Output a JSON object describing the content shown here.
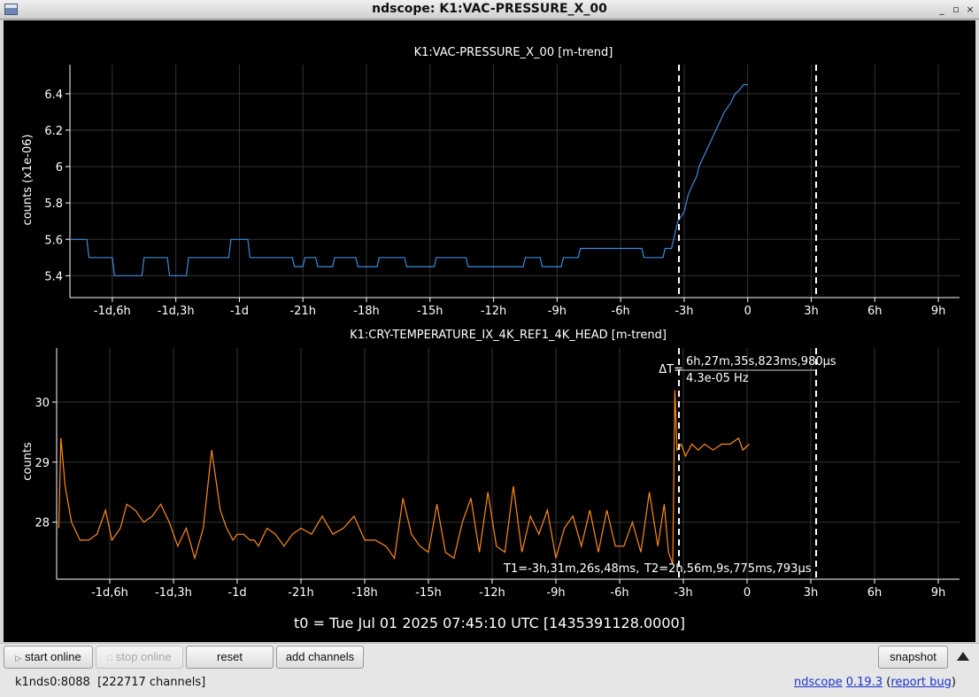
{
  "window": {
    "title": "ndscope: K1:VAC-PRESSURE_X_00"
  },
  "colors": {
    "plot_bg": "#000000",
    "grid": "#333333",
    "axis_text": "#ffffff",
    "series1": "#3c8cd8",
    "series2": "#ff8a1a",
    "cursor": "#ffffff"
  },
  "plots": [
    {
      "title": "K1:VAC-PRESSURE_X_00 [m-trend]",
      "ylabel": "counts (x1e-06)",
      "yticks": [
        "5.4",
        "5.6",
        "5.8",
        "6",
        "6.2",
        "6.4"
      ],
      "xticks": [
        "-1d,6h",
        "-1d,3h",
        "-1d",
        "-21h",
        "-18h",
        "-15h",
        "-12h",
        "-9h",
        "-6h",
        "-3h",
        "0",
        "3h",
        "6h",
        "9h"
      ]
    },
    {
      "title": "K1:CRY-TEMPERATURE_IX_4K_REF1_4K_HEAD [m-trend]",
      "ylabel": "counts",
      "yticks": [
        "28",
        "29",
        "30"
      ],
      "xticks": [
        "-1d,6h",
        "-1d,3h",
        "-1d",
        "-21h",
        "-18h",
        "-15h",
        "-12h",
        "-9h",
        "-6h",
        "-3h",
        "0",
        "3h",
        "6h",
        "9h"
      ],
      "cursor": {
        "delta_label": "ΔT=",
        "delta_value": "6h,27m,35s,823ms,980µs",
        "freq": "4.3e-05 Hz",
        "t1": "T1=-3h,31m,26s,48ms,",
        "t2": "T2=2h,56m,9s,775ms,793µs"
      }
    }
  ],
  "t0_label": "t0 = Tue Jul 01 2025 07:45:10 UTC [1435391128.0000]",
  "toolbar": {
    "start_online": "start online",
    "stop_online": "stop online",
    "reset": "reset",
    "add_channels": "add channels",
    "snapshot": "snapshot"
  },
  "status": {
    "server": "k1nds0:8088",
    "channels": "[222717 channels]",
    "app_name": "ndscope",
    "version": "0.19.3",
    "report_bug": "report bug"
  },
  "chart_data": [
    {
      "type": "line",
      "title": "K1:VAC-PRESSURE_X_00 [m-trend]",
      "ylabel": "counts (x1e-06)",
      "xlabel": "",
      "x_unit": "hours",
      "xlim": [
        -32,
        10
      ],
      "ylim": [
        5.28,
        6.56
      ],
      "grid": true,
      "series": [
        {
          "color": "#3c8cd8",
          "x": [
            -32,
            -31.2,
            -31.1,
            -30,
            -29.9,
            -28.6,
            -28.5,
            -27.4,
            -27.3,
            -26.5,
            -26.4,
            -24.5,
            -24.4,
            -23.6,
            -23.5,
            -21.5,
            -21.4,
            -21.0,
            -20.9,
            -20.4,
            -20.3,
            -19.6,
            -19.5,
            -18.5,
            -18.4,
            -17.5,
            -17.4,
            -16.2,
            -16.1,
            -14.8,
            -14.7,
            -13.3,
            -13.2,
            -10.6,
            -10.5,
            -9.8,
            -9.7,
            -8.8,
            -8.7,
            -8.0,
            -7.9,
            -5.0,
            -4.9,
            -4.0,
            -3.9,
            -3.6,
            -3.5,
            -3.3,
            -3.0,
            -2.8,
            -2.6,
            -2.4,
            -2.3,
            -2.1,
            -1.9,
            -1.7,
            -1.5,
            -1.3,
            -1.1,
            -0.8,
            -0.6,
            -0.4,
            -0.2,
            0.0
          ],
          "y": [
            5.6,
            5.6,
            5.5,
            5.5,
            5.4,
            5.4,
            5.5,
            5.5,
            5.4,
            5.4,
            5.5,
            5.5,
            5.6,
            5.6,
            5.5,
            5.5,
            5.45,
            5.45,
            5.5,
            5.5,
            5.45,
            5.45,
            5.5,
            5.5,
            5.45,
            5.45,
            5.5,
            5.5,
            5.45,
            5.45,
            5.5,
            5.5,
            5.45,
            5.45,
            5.5,
            5.5,
            5.45,
            5.45,
            5.5,
            5.5,
            5.55,
            5.55,
            5.5,
            5.5,
            5.55,
            5.55,
            5.6,
            5.7,
            5.75,
            5.85,
            5.9,
            5.95,
            6.0,
            6.05,
            6.1,
            6.15,
            6.2,
            6.25,
            6.3,
            6.35,
            6.4,
            6.42,
            6.45,
            6.45
          ]
        }
      ]
    },
    {
      "type": "line",
      "title": "K1:CRY-TEMPERATURE_IX_4K_REF1_4K_HEAD [m-trend]",
      "ylabel": "counts",
      "xlabel": "",
      "x_unit": "hours",
      "xlim": [
        -32.5,
        10
      ],
      "ylim": [
        27.05,
        30.9
      ],
      "grid": true,
      "series": [
        {
          "color": "#ff8a1a",
          "x": [
            -32.4,
            -32.3,
            -32.1,
            -31.8,
            -31.4,
            -31.0,
            -30.6,
            -30.2,
            -29.9,
            -29.5,
            -29.2,
            -28.8,
            -28.4,
            -28.0,
            -27.6,
            -27.2,
            -26.8,
            -26.4,
            -26.0,
            -25.6,
            -25.2,
            -24.8,
            -24.5,
            -24.2,
            -24.0,
            -23.7,
            -23.4,
            -23.2,
            -23.0,
            -22.6,
            -22.2,
            -21.8,
            -21.4,
            -21.0,
            -20.5,
            -20.0,
            -19.5,
            -19.0,
            -18.5,
            -18.0,
            -17.5,
            -17.0,
            -16.6,
            -16.2,
            -15.8,
            -15.4,
            -15.0,
            -14.6,
            -14.2,
            -13.8,
            -13.4,
            -13.0,
            -12.6,
            -12.2,
            -11.8,
            -11.4,
            -11.0,
            -10.6,
            -10.2,
            -9.8,
            -9.4,
            -9.0,
            -8.6,
            -8.2,
            -7.8,
            -7.4,
            -7.0,
            -6.6,
            -6.2,
            -5.8,
            -5.4,
            -5.0,
            -4.6,
            -4.2,
            -3.9,
            -3.7,
            -3.5,
            -3.4,
            -3.3,
            -3.1,
            -2.9,
            -2.6,
            -2.3,
            -2.0,
            -1.6,
            -1.2,
            -0.8,
            -0.4,
            -0.2,
            0.1
          ],
          "y": [
            27.9,
            29.4,
            28.6,
            28.0,
            27.7,
            27.7,
            27.8,
            28.2,
            27.7,
            27.9,
            28.3,
            28.2,
            28.0,
            28.1,
            28.3,
            28.0,
            27.6,
            27.9,
            27.4,
            27.9,
            29.2,
            28.2,
            27.9,
            27.7,
            27.8,
            27.8,
            27.7,
            27.7,
            27.6,
            27.9,
            27.8,
            27.6,
            27.8,
            27.9,
            27.8,
            28.1,
            27.8,
            27.9,
            28.1,
            27.7,
            27.7,
            27.6,
            27.4,
            28.4,
            27.8,
            27.6,
            27.5,
            28.3,
            27.5,
            27.4,
            28.0,
            28.4,
            27.5,
            28.5,
            27.6,
            27.5,
            28.6,
            27.5,
            28.1,
            27.8,
            28.2,
            27.4,
            27.9,
            28.1,
            27.6,
            28.2,
            27.5,
            28.2,
            27.6,
            27.6,
            28.0,
            27.5,
            28.5,
            27.6,
            28.3,
            27.5,
            27.3,
            30.2,
            29.2,
            29.3,
            29.1,
            29.3,
            29.2,
            29.3,
            29.2,
            29.3,
            29.3,
            29.4,
            29.2,
            29.3
          ]
        }
      ]
    }
  ]
}
